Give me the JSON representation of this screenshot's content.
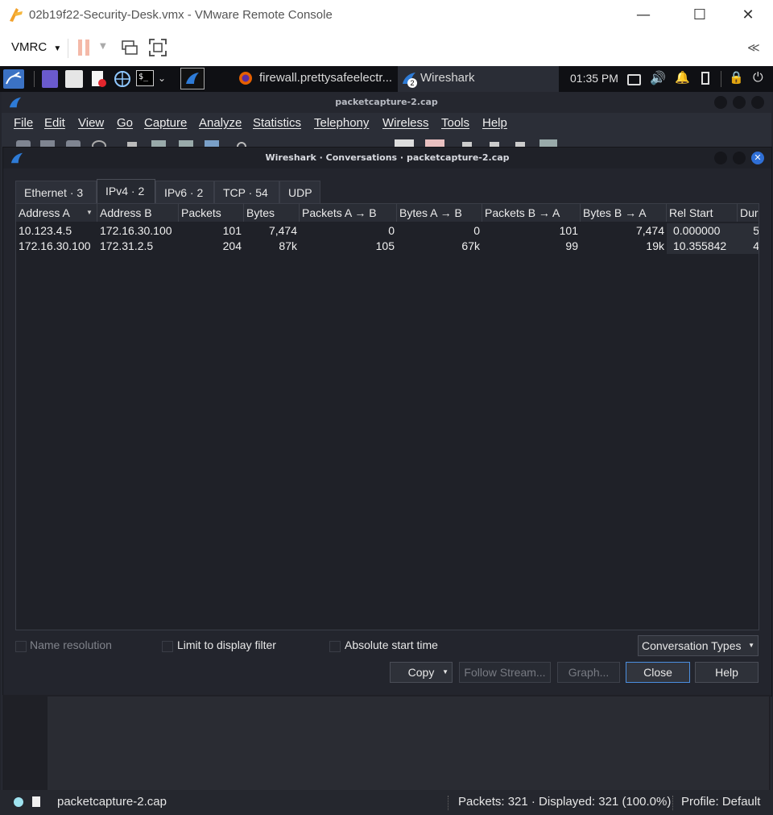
{
  "vmrc": {
    "window_title": "02b19f22-Security-Desk.vmx - VMware Remote Console",
    "menu_label": "VMRC",
    "minimize_glyph": "—",
    "maximize_glyph": "☐",
    "close_glyph": "✕",
    "collapse_glyph": "≪"
  },
  "panel": {
    "task_firefox": "firewall.prettysafeelectr...",
    "task_wireshark": "Wireshark",
    "wireshark_badge": "2",
    "clock": "01:35 PM"
  },
  "wireshark": {
    "title": "packetcapture-2.cap",
    "menu": [
      "File",
      "Edit",
      "View",
      "Go",
      "Capture",
      "Analyze",
      "Statistics",
      "Telephony",
      "Wireless",
      "Tools",
      "Help"
    ]
  },
  "dialog": {
    "title": "Wireshark · Conversations · packetcapture-2.cap",
    "tabs": [
      "Ethernet · 3",
      "IPv4 · 2",
      "IPv6 · 2",
      "TCP · 54",
      "UDP"
    ],
    "active_tab": "IPv4 · 2",
    "columns": [
      "Address A",
      "Address B",
      "Packets",
      "Bytes",
      "Packets A → B",
      "Bytes A → B",
      "Packets B → A",
      "Bytes B → A",
      "Rel Start",
      "Dur"
    ],
    "rows": [
      [
        "10.123.4.5",
        "172.16.30.100",
        "101",
        "7,474",
        "0",
        "0",
        "101",
        "7,474",
        "0.000000",
        "5"
      ],
      [
        "172.16.30.100",
        "172.31.2.5",
        "204",
        "87k",
        "105",
        "67k",
        "99",
        "19k",
        "10.355842",
        "4"
      ]
    ],
    "options": {
      "name_resolution": "Name resolution",
      "limit_display_filter": "Limit to display filter",
      "absolute_start_time": "Absolute start time"
    },
    "conversation_types": "Conversation Types",
    "buttons": {
      "copy": "Copy",
      "follow_stream": "Follow Stream...",
      "graph": "Graph...",
      "close": "Close",
      "help": "Help"
    }
  },
  "statusbar": {
    "file": "packetcapture-2.cap",
    "packets": "Packets: 321 · Displayed: 321 (100.0%)",
    "profile": "Profile: Default"
  },
  "colors": {
    "accent": "#4b8fe0",
    "dialog_bg": "#23252d",
    "close_circle": "#2f6fd6"
  }
}
